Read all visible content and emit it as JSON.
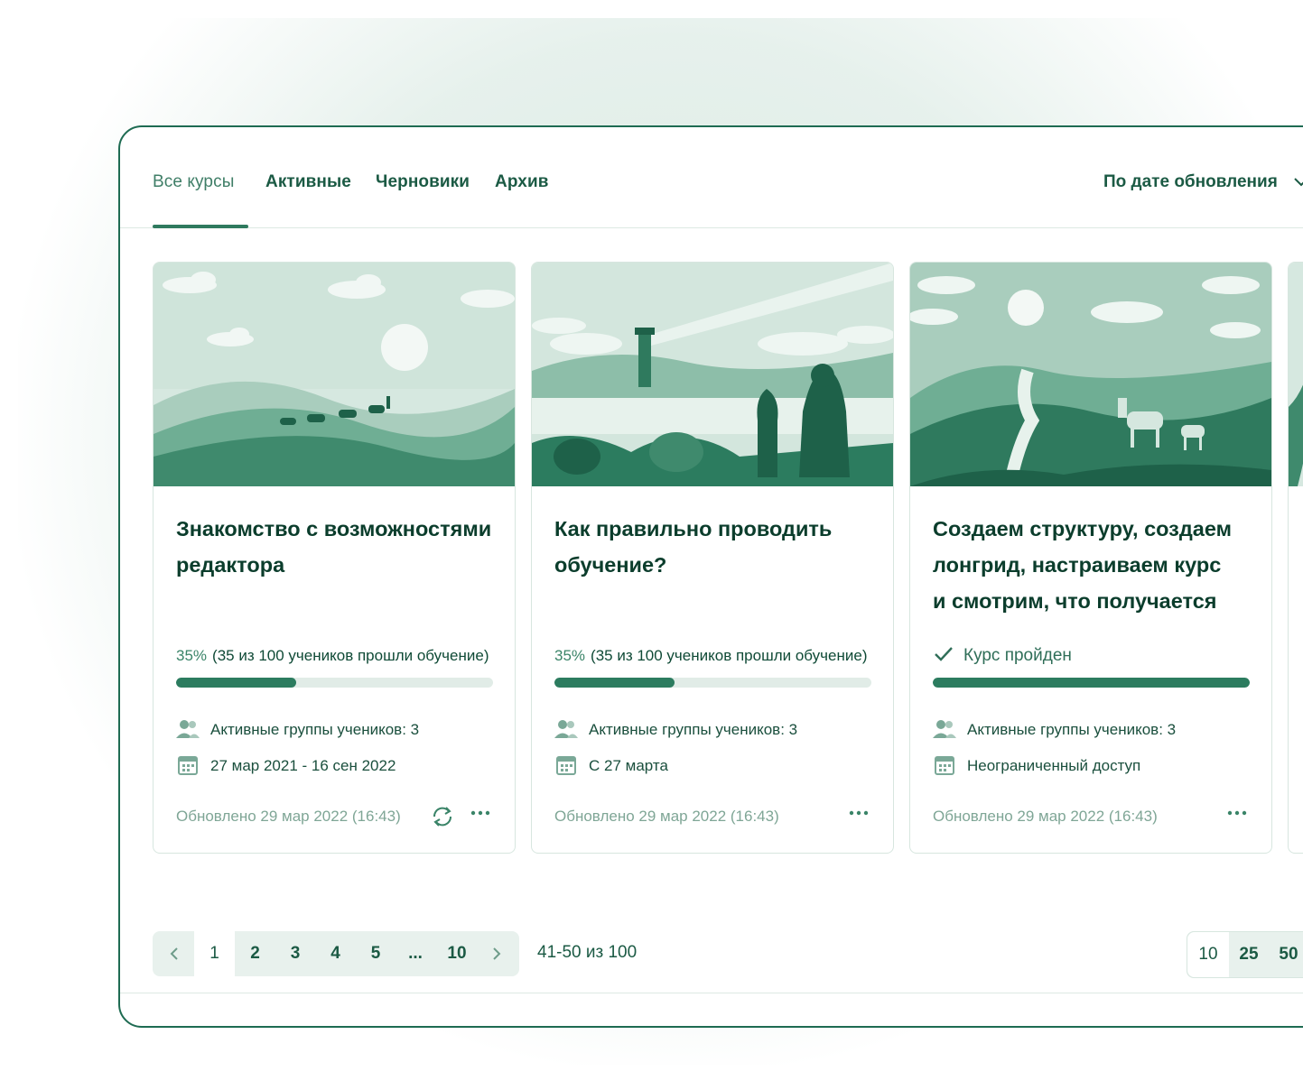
{
  "tabs": [
    {
      "label": "Все курсы",
      "active": true
    },
    {
      "label": "Активные"
    },
    {
      "label": "Черновики"
    },
    {
      "label": "Архив"
    }
  ],
  "sort": {
    "label": "По дате обновления",
    "icon": "chevron-down-icon"
  },
  "cards": [
    {
      "title_line1": "Знакомство с возможностями",
      "title_line2": "редактора",
      "progress_percent": "35%",
      "progress_text": "(35 из 100 учеников прошли обучение)",
      "progress_fraction": 0.38,
      "groups": "Активные группы учеников:  3",
      "dates": "27 мар 2021 - 16 сен 2022",
      "updated": "Обновлено 29 мар 2022 (16:43)",
      "illustration": "desert-camels"
    },
    {
      "title_line1": "Как правильно проводить",
      "title_line2": "обучение?",
      "progress_percent": "35%",
      "progress_text": "(35 из 100 учеников прошли обучение)",
      "progress_fraction": 0.38,
      "groups": "Активные группы учеников:  3",
      "dates": "С 27 марта",
      "updated": "Обновлено 29 мар 2022 (16:43)",
      "illustration": "lighthouse-girl-cat"
    },
    {
      "title_line1": "Создаем структуру, создаем",
      "title_line2": "лонгрид, настраиваем курс",
      "title_line3": "и смотрим, что получается",
      "done_label": "Курс пройден",
      "progress_fraction": 1.0,
      "groups": "Активные группы учеников:  3",
      "dates": "Неограниченный доступ",
      "updated": "Обновлено 29 мар 2022 (16:43)",
      "illustration": "hills-deer"
    }
  ],
  "pagination": {
    "pages": [
      "1",
      "2",
      "3",
      "4",
      "5",
      "...",
      "10"
    ],
    "current": "1",
    "range": "41-50 из 100",
    "per_page": [
      "10",
      "25",
      "50"
    ],
    "per_page_selected": "10"
  },
  "colors": {
    "primary": "#1b5a44",
    "accent": "#2c7c5f",
    "illustration_light": "#cfe3da",
    "illustration_dark": "#2f7a5e"
  }
}
